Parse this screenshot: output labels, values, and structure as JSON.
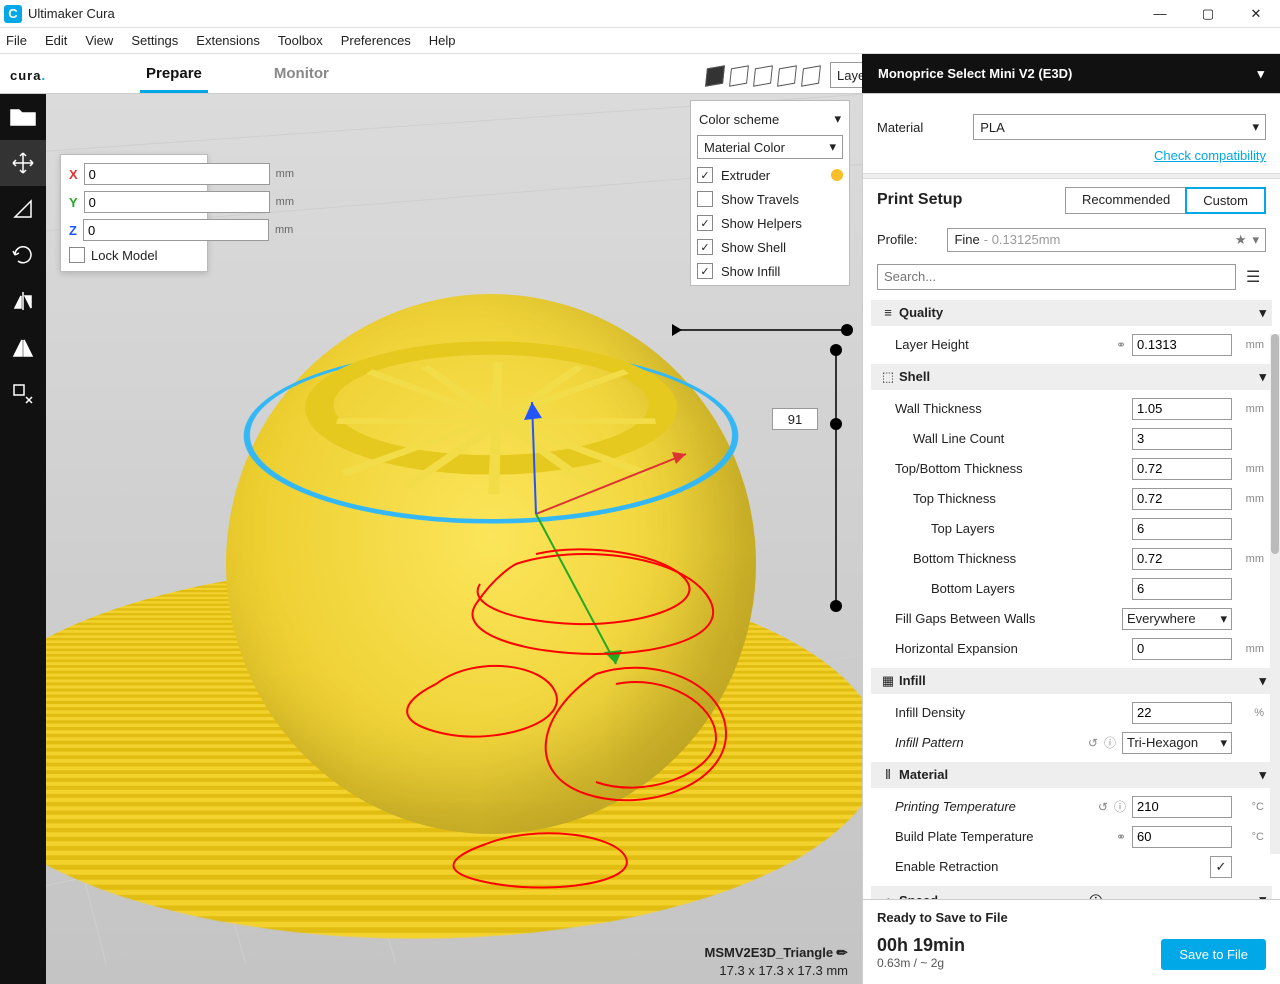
{
  "app_title": "Ultimaker Cura",
  "menus": [
    "File",
    "Edit",
    "View",
    "Settings",
    "Extensions",
    "Toolbox",
    "Preferences",
    "Help"
  ],
  "brand": "cura",
  "stages": {
    "prepare": "Prepare",
    "monitor": "Monitor"
  },
  "view_mode": "Layer view",
  "printer": "Monoprice Select Mini V2 (E3D)",
  "transform": {
    "x": "0",
    "y": "0",
    "z": "0",
    "unit": "mm",
    "lock_label": "Lock Model"
  },
  "layer_panel": {
    "color_label": "Color scheme",
    "color_value": "Material Color",
    "items": [
      {
        "label": "Extruder",
        "checked": true,
        "color": "#f8bf2b"
      },
      {
        "label": "Show Travels",
        "checked": false
      },
      {
        "label": "Show Helpers",
        "checked": true
      },
      {
        "label": "Show Shell",
        "checked": true
      },
      {
        "label": "Show Infill",
        "checked": true
      }
    ]
  },
  "slider_layer": "91",
  "object": {
    "name": "MSMV2E3D_Triangle",
    "size": "17.3 x 17.3 x 17.3 mm"
  },
  "material_label": "Material",
  "material_value": "PLA",
  "compat_link": "Check compatibility",
  "print_setup": "Print Setup",
  "tabs": {
    "rec": "Recommended",
    "cust": "Custom"
  },
  "profile_label": "Profile:",
  "profile_name": "Fine",
  "profile_detail": "- 0.13125mm",
  "search_ph": "Search...",
  "sections": {
    "quality": "Quality",
    "shell": "Shell",
    "infill": "Infill",
    "material": "Material",
    "speed": "Speed"
  },
  "settings": {
    "layer_height": {
      "label": "Layer Height",
      "value": "0.1313",
      "unit": "mm"
    },
    "wall_thick": {
      "label": "Wall Thickness",
      "value": "1.05",
      "unit": "mm"
    },
    "wall_lines": {
      "label": "Wall Line Count",
      "value": "3"
    },
    "tb_thick": {
      "label": "Top/Bottom Thickness",
      "value": "0.72",
      "unit": "mm"
    },
    "top_thick": {
      "label": "Top Thickness",
      "value": "0.72",
      "unit": "mm"
    },
    "top_layers": {
      "label": "Top Layers",
      "value": "6"
    },
    "bot_thick": {
      "label": "Bottom Thickness",
      "value": "0.72",
      "unit": "mm"
    },
    "bot_layers": {
      "label": "Bottom Layers",
      "value": "6"
    },
    "fill_gaps": {
      "label": "Fill Gaps Between Walls",
      "value": "Everywhere"
    },
    "hor_exp": {
      "label": "Horizontal Expansion",
      "value": "0",
      "unit": "mm"
    },
    "infill_d": {
      "label": "Infill Density",
      "value": "22",
      "unit": "%"
    },
    "infill_p": {
      "label": "Infill Pattern",
      "value": "Tri-Hexagon"
    },
    "print_t": {
      "label": "Printing Temperature",
      "value": "210",
      "unit": "°C"
    },
    "bed_t": {
      "label": "Build Plate Temperature",
      "value": "60",
      "unit": "°C"
    },
    "retract": {
      "label": "Enable Retraction"
    }
  },
  "bottom": {
    "ready": "Ready to Save to File",
    "time": "00h 19min",
    "meta": "0.63m / ~ 2g",
    "save": "Save to File"
  }
}
